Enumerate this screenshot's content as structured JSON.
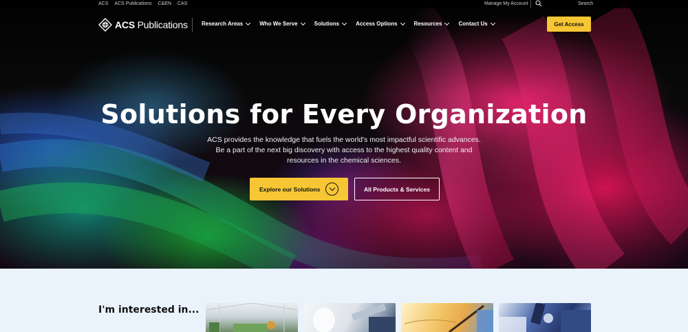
{
  "utility": {
    "links": [
      "ACS",
      "ACS Publications",
      "C&EN",
      "CAS"
    ],
    "manage_account": "Manage My Account",
    "search_label": "Search"
  },
  "nav": {
    "logo_acs": "ACS",
    "logo_publications": "Publications",
    "items": [
      {
        "label": "Research Areas"
      },
      {
        "label": "Who We Serve"
      },
      {
        "label": "Solutions"
      },
      {
        "label": "Access Options"
      },
      {
        "label": "Resources"
      },
      {
        "label": "Contact Us"
      }
    ],
    "get_access": "Get Access"
  },
  "hero": {
    "title": "Solutions for Every Organization",
    "subtitle_line1": "ACS provides the knowledge that fuels the world's most impactful scientific advances.",
    "subtitle_line2": "Be a part of the next big discovery with access to the highest quality content and",
    "subtitle_line3": "resources in the chemical sciences.",
    "explore_button": "Explore our Solutions",
    "products_button": "All Products & Services"
  },
  "interested": {
    "title": "I'm interested in..."
  },
  "colors": {
    "accent_yellow": "#f6c634",
    "section_background": "#eaf2fb",
    "text_dark": "#111111"
  },
  "icons": [
    "search-icon",
    "acs-logo-icon",
    "chevron-down-icon",
    "circle-chevron-down-icon"
  ]
}
